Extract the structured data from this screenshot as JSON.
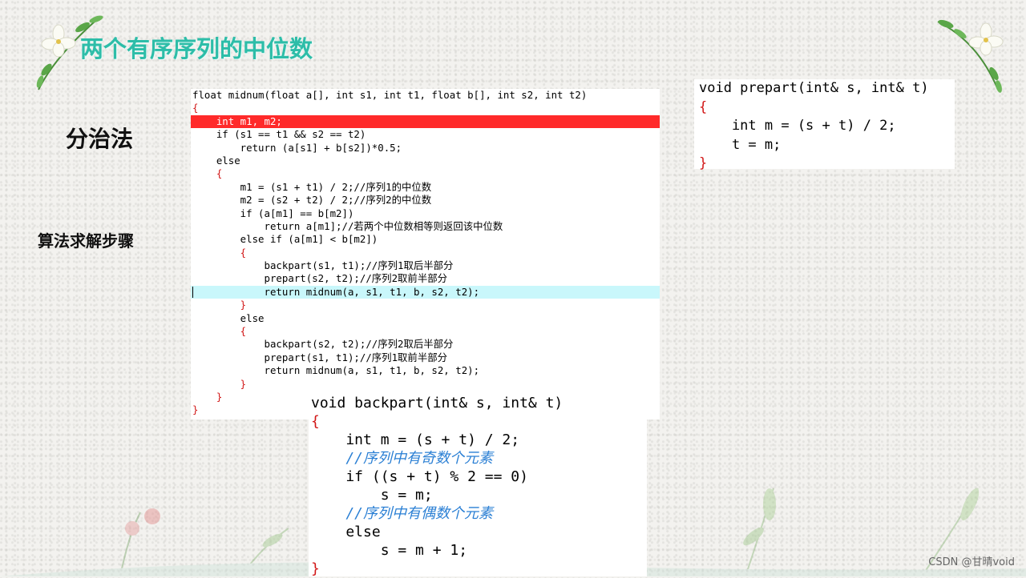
{
  "slide": {
    "title": "两个有序序列的中位数",
    "label_method": "分治法",
    "label_steps": "算法求解步骤",
    "watermark": "CSDN @甘晴void"
  },
  "main_code": {
    "lines": [
      "float midnum(float a[], int s1, int t1, float b[], int s2, int t2)",
      "{",
      "    int m1, m2;",
      "    if (s1 == t1 && s2 == t2)",
      "        return (a[s1] + b[s2])*0.5;",
      "    else",
      "    {",
      "        m1 = (s1 + t1) / 2;//序列1的中位数",
      "        m2 = (s2 + t2) / 2;//序列2的中位数",
      "        if (a[m1] == b[m2])",
      "            return a[m1];//若两个中位数相等则返回该中位数",
      "        else if (a[m1] < b[m2])",
      "        {",
      "            backpart(s1, t1);//序列1取后半部分",
      "            prepart(s2, t2);//序列2取前半部分",
      "            return midnum(a, s1, t1, b, s2, t2);",
      "        }",
      "        else",
      "        {",
      "            backpart(s2, t2);//序列2取后半部分",
      "            prepart(s1, t1);//序列1取前半部分",
      "            return midnum(a, s1, t1, b, s2, t2);",
      "        }",
      "    }",
      "}"
    ]
  },
  "prepart_code": {
    "lines": [
      "void prepart(int& s, int& t)",
      "{",
      "    int m = (s + t) / 2;",
      "    t = m;",
      "}"
    ]
  },
  "backpart_code": {
    "lines": [
      "void backpart(int& s, int& t)",
      "{",
      "    int m = (s + t) / 2;",
      "    //序列中有奇数个元素",
      "    if ((s + t) % 2 == 0)",
      "        s = m;",
      "    //序列中有偶数个元素",
      "    else",
      "        s = m + 1;",
      "}"
    ]
  },
  "colors": {
    "title": "#2dbda8",
    "error_highlight": "#ff2a2a",
    "current_line_highlight": "#c9f7fb",
    "comment": "#2a7fd4",
    "operator": "#d11616",
    "number": "#8a1fa6"
  }
}
